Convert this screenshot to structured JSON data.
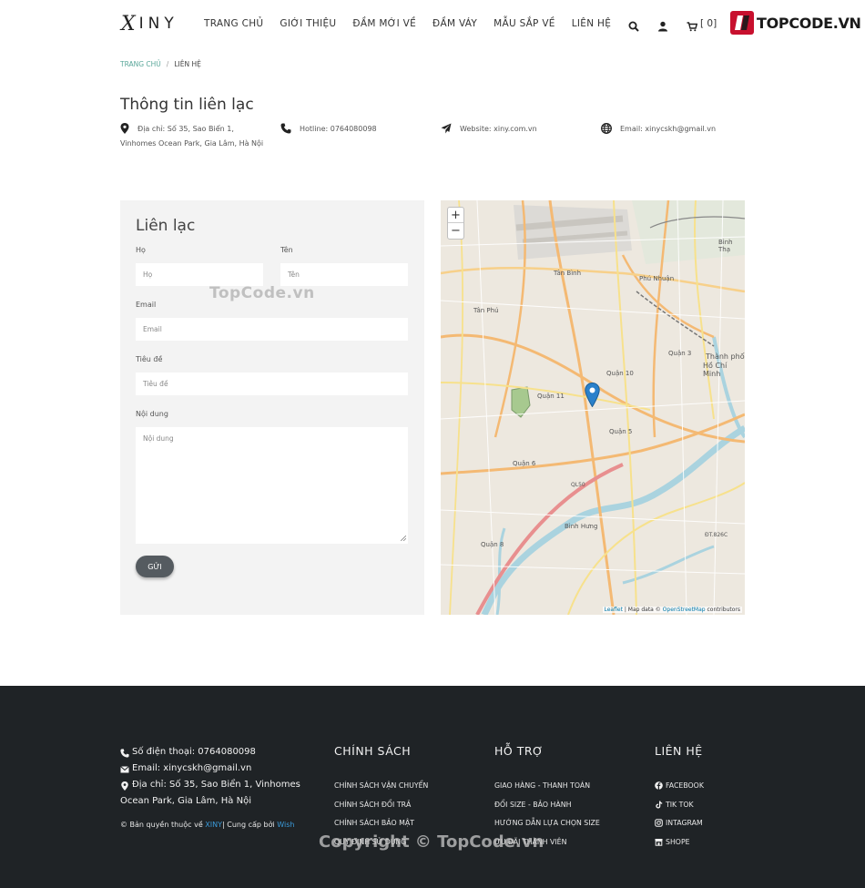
{
  "header": {
    "logo_text": "INY",
    "logo_mark": "X",
    "nav": [
      "TRANG CHỦ",
      "GIỚI THIỆU",
      "ĐẦM MỚI VỀ",
      "ĐẦM VÁY",
      "MẪU SẮP VỀ",
      "LIÊN HỆ"
    ],
    "cart_count": "[ 0]",
    "icons": [
      "search-icon",
      "user-icon",
      "cart-icon"
    ],
    "badge_text": "TOPCODE.VN"
  },
  "breadcrumb": {
    "home": "TRANG CHỦ",
    "separator": "/",
    "current": "LIÊN HỆ"
  },
  "contact_info": {
    "title": "Thông tin liên lạc",
    "address": "Địa chỉ: Số 35, Sao Biển 1, Vinhomes Ocean Park, Gia Lâm, Hà Nội",
    "hotline": "Hotline: 0764080098",
    "website": "Website: xiny.com.vn",
    "email": "Email: xinycskh@gmail.vn"
  },
  "form": {
    "title": "Liên lạc",
    "last_name_label": "Họ",
    "last_name_placeholder": "Họ",
    "first_name_label": "Tên",
    "first_name_placeholder": "Tên",
    "email_label": "Email",
    "email_placeholder": "Email",
    "subject_label": "Tiêu đề",
    "subject_placeholder": "Tiêu đề",
    "content_label": "Nội dung",
    "content_placeholder": "Nội dung",
    "submit_label": "GỬI"
  },
  "watermarks": {
    "center": "TopCode.vn",
    "footer": "Copyright © TopCode.vn"
  },
  "map": {
    "zoom_in": "+",
    "zoom_out": "−",
    "attribution_leaflet": "Leaflet",
    "attribution_mid": " | Map data © ",
    "attribution_osm": "OpenStreetMap",
    "attribution_end": " contributors",
    "labels": {
      "tan_binh": "Tân Bình",
      "phu_nhuan": "Phú Nhuận",
      "tan_phu": "Tân Phú",
      "quan_3": "Quận 3",
      "quan_10": "Quận 10",
      "quan_11": "Quận 11",
      "quan_5": "Quận 5",
      "quan_6": "Quận 6",
      "quan_8": "Quận 8",
      "binh_hung": "Bình Hưng",
      "thanh_pho": "Thành phố",
      "ho_chi_minh": "Hồ Chí Minh",
      "binh_thanh": "Bình Thạ",
      "ql50": "QL50",
      "dt826c": "ĐT.826C"
    },
    "marker_color": "#2a81cb"
  },
  "footer": {
    "phone": "Số điện thoại: 0764080098",
    "email": "Email: xinycskh@gmail.vn",
    "address_line1": "Địa chỉ: Số 35, Sao Biển 1, Vinhomes",
    "address_line2": "Ocean Park, Gia Lâm, Hà Nội",
    "copyright_prefix": "© Bản quyền thuộc về ",
    "copyright_brand": "XINY",
    "copyright_mid": "| Cung cấp bởi ",
    "copyright_provider": "Wish",
    "policy_title": "CHÍNH SÁCH",
    "policy_links": [
      "CHÍNH SÁCH VẬN CHUYỂN",
      "CHÍNH SÁCH ĐỔI TRẢ",
      "CHÍNH SÁCH BẢO MẬT",
      "QUY ĐỊNH SỬ DỤNG"
    ],
    "support_title": "HỖ TRỢ",
    "support_links": [
      "GIAO HÀNG - THANH TOÁN",
      "ĐỔI SIZE - BẢO HÀNH",
      "HƯỚNG DẪN LỰA CHỌN SIZE",
      "ƯU ĐÃI THÀNH VIÊN"
    ],
    "contact_title": "LIÊN HỆ",
    "social_links": [
      "FACEBOOK",
      "TIK TOK",
      "INTAGRAM",
      "SHOPE"
    ]
  },
  "colors": {
    "footer_bg": "#1f2326",
    "accent_link": "#3a9ad9",
    "breadcrumb_home": "#5aa79a",
    "badge_red": "#c8102e"
  }
}
